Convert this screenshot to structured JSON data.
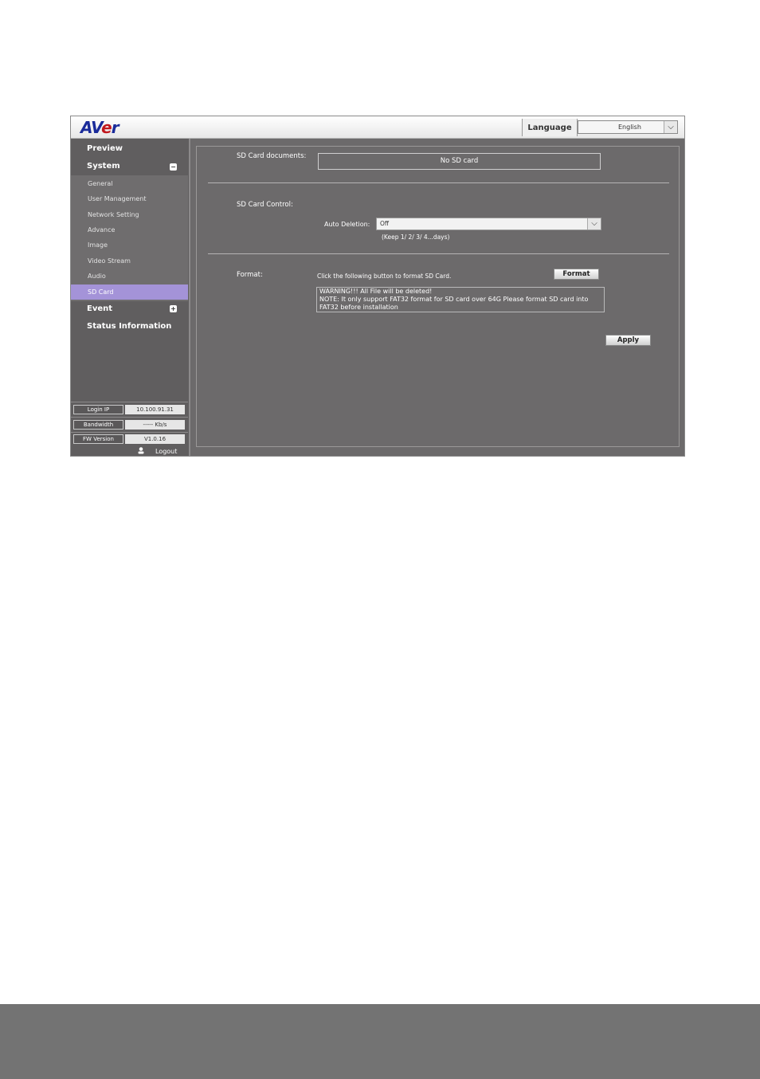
{
  "header": {
    "logo_prefix": "AV",
    "logo_e": "e",
    "logo_suffix": "r",
    "language_label": "Language",
    "language_value": "English"
  },
  "sidebar": {
    "preview": "Preview",
    "system": "System",
    "system_items": [
      "General",
      "User Management",
      "Network Setting",
      "Advance",
      "Image",
      "Video Stream",
      "Audio",
      "SD Card"
    ],
    "active_item": "SD Card",
    "event": "Event",
    "status_information": "Status Information",
    "info": {
      "login_ip_label": "Login IP",
      "login_ip_value": "10.100.91.31",
      "bandwidth_label": "Bandwidth",
      "bandwidth_value": "----- Kb/s",
      "fw_version_label": "FW Version",
      "fw_version_value": "V1.0.16"
    },
    "logout": "Logout"
  },
  "main": {
    "sd_documents_label": "SD Card documents:",
    "sd_documents_value": "No SD card",
    "sd_control_label": "SD Card Control:",
    "auto_deletion_label": "Auto Deletion:",
    "auto_deletion_value": "Off",
    "auto_deletion_hint": "(Keep 1/ 2/ 3/ 4...days)",
    "format_label": "Format:",
    "format_instruction": "Click the following button to format SD Card.",
    "format_button": "Format",
    "warning_line1": "WARNING!!! All File will be deleted!",
    "warning_line2": "NOTE: It only support FAT32 format for SD card over 64G Please format SD card into FAT32 before installation",
    "apply_button": "Apply"
  }
}
